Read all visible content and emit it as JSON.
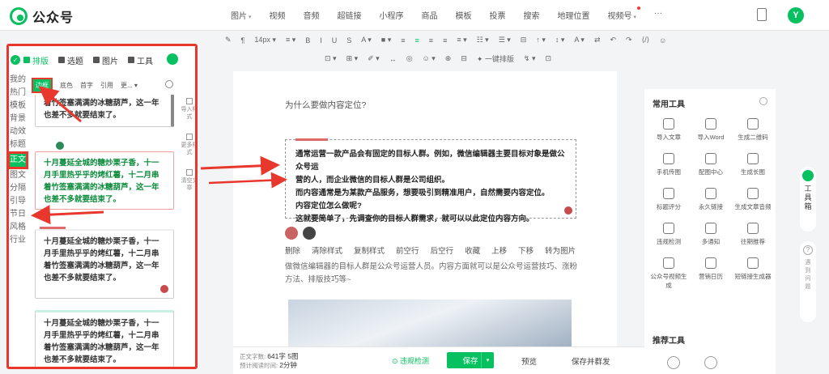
{
  "app": {
    "logo_text": "公众号"
  },
  "topnav": {
    "items": [
      {
        "label": "图片",
        "caret": true
      },
      {
        "label": "视频",
        "caret": false
      },
      {
        "label": "音频",
        "caret": false
      },
      {
        "label": "超链接",
        "caret": false
      },
      {
        "label": "小程序",
        "caret": false
      },
      {
        "label": "商品",
        "caret": false
      },
      {
        "label": "模板",
        "caret": false
      },
      {
        "label": "投票",
        "caret": false
      },
      {
        "label": "搜索",
        "caret": false
      },
      {
        "label": "地理位置",
        "caret": false
      },
      {
        "label": "视频号",
        "caret": true
      },
      {
        "label": "···",
        "caret": false
      }
    ],
    "avatar": "Y"
  },
  "toolbar": {
    "row1": [
      "✎",
      "¶",
      "14px ▾",
      "≡ ▾",
      "B",
      "I",
      "U",
      "S",
      "A ▾",
      "■ ▾",
      "≡",
      "≡",
      "≡",
      "≡",
      "≡ ▾",
      "☷ ▾",
      "☰ ▾",
      "⊟",
      "↑ ▾",
      "↕ ▾",
      "A ▾",
      "⇄",
      "↶",
      "↷",
      "⟨/⟩",
      "☺"
    ],
    "row2": [
      "⊡ ▾",
      "⊞ ▾",
      "✐ ▾",
      "↔",
      "◎",
      "☺ ▾",
      "⊕",
      "⊟",
      "✦ 一键排版",
      "↯ ▾",
      "⊡"
    ]
  },
  "left_panel": {
    "tabs": [
      {
        "label": "排版",
        "active": true
      },
      {
        "label": "选题",
        "active": false
      },
      {
        "label": "图片",
        "active": false
      },
      {
        "label": "工具",
        "active": false
      }
    ],
    "side_nav": [
      {
        "label": "我的",
        "active": false
      },
      {
        "label": "热门",
        "active": false
      },
      {
        "label": "模板",
        "active": false
      },
      {
        "label": "背景",
        "active": false
      },
      {
        "label": "动效",
        "active": false
      },
      {
        "label": "标题",
        "active": false
      },
      {
        "label": "正文",
        "active": true
      },
      {
        "label": "图文",
        "active": false
      },
      {
        "label": "分隔",
        "active": false
      },
      {
        "label": "引导",
        "active": false
      },
      {
        "label": "节日",
        "active": false
      },
      {
        "label": "风格",
        "active": false
      },
      {
        "label": "行业",
        "active": false
      }
    ],
    "subtabs": [
      {
        "label": "边框",
        "active": true
      },
      {
        "label": "底色",
        "active": false
      },
      {
        "label": "首字",
        "active": false
      },
      {
        "label": "引用",
        "active": false
      },
      {
        "label": "更... ▾",
        "active": false
      }
    ],
    "cards": [
      {
        "text": "着竹签塞满满的冰糖葫芦，这一年也差不多就要结束了。"
      },
      {
        "text": "十月蔓延全城的糖炒栗子香，十一月手里热乎乎的烤红薯，十二月串着竹签塞满满的冰糖葫芦，这一年也差不多就要结束了。"
      },
      {
        "text": "十月蔓延全城的糖炒栗子香，十一月手里热乎乎的烤红薯，十二月串着竹签塞满满的冰糖葫芦，这一年也差不多就要结束了。"
      },
      {
        "text": "十月蔓延全城的糖炒栗子香，十一月手里热乎乎的烤红薯，十二月串着竹签塞满满的冰糖葫芦，这一年也差不多就要结束了。"
      }
    ],
    "tools": [
      {
        "label": "导入样式"
      },
      {
        "label": "更多样式"
      },
      {
        "label": "清空文章"
      }
    ]
  },
  "doc": {
    "title": "为什么要做内容定位?",
    "selected_block": [
      "通常运营一款产品会有固定的目标人群。例如，微信编辑器主要目标对象是做公众号运",
      "营的人，而企业微信的目标人群是公司组织。",
      "而内容通常是为某款产品服务，想要吸引到精准用户，自然需要内容定位。",
      "内容定位怎么做呢?",
      "这就要简单了，先调查你的目标人群需求，就可以以此定位内容方向。"
    ],
    "color_swatches": [
      "#c86464",
      "#444444"
    ],
    "actions": [
      "删除",
      "清除样式",
      "复制样式",
      "前空行",
      "后空行",
      "收藏",
      "上移",
      "下移",
      "转为图片"
    ],
    "body": "做微信编辑器的目标人群是公众号运营人员。内容方面就可以是公众号运营技巧、涨粉方法、排版技巧等~"
  },
  "bottom": {
    "stats_label1": "正文字数:",
    "char_count": "641字 5图",
    "stats_label2": "预计阅读时间:",
    "read_time": "2分钟",
    "check_label": "⊙ 违规检测",
    "save_label": "保存",
    "save_caret": "▾",
    "preview_label": "预览",
    "save_send_label": "保存并群发"
  },
  "right_panel": {
    "title": "常用工具",
    "tools": [
      {
        "label": "导入文章"
      },
      {
        "label": "导入Word"
      },
      {
        "label": "生成二维码"
      },
      {
        "label": "手机传图"
      },
      {
        "label": "配图中心"
      },
      {
        "label": "生成长图"
      },
      {
        "label": "标题评分"
      },
      {
        "label": "永久链接"
      },
      {
        "label": "生成文章音频"
      },
      {
        "label": "违规检测"
      },
      {
        "label": "多通知"
      },
      {
        "label": "往期推荐"
      },
      {
        "label": "公众号视频生成"
      },
      {
        "label": "营销日历"
      },
      {
        "label": "短链接生成器"
      }
    ],
    "title2": "推荐工具"
  },
  "far_right": {
    "tab1": [
      "工",
      "具",
      "箱"
    ],
    "tab2": [
      "遇",
      "到",
      "问",
      "题"
    ]
  },
  "colors": {
    "accent": "#07c160",
    "highlight": "#e8382e"
  }
}
